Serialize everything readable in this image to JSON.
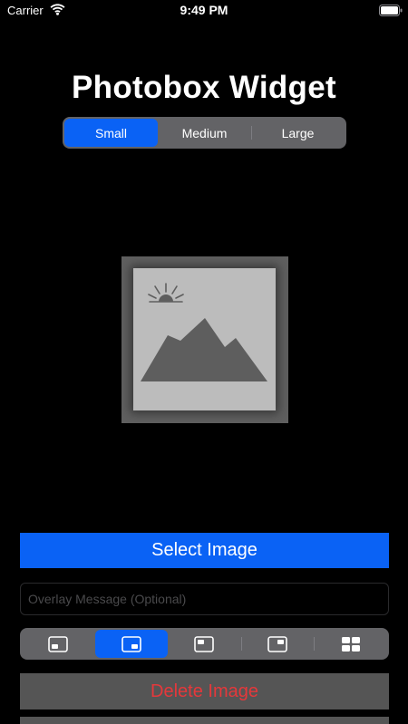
{
  "status_bar": {
    "carrier": "Carrier",
    "time": "9:49 PM",
    "icons": [
      "wifi-icon",
      "battery-icon"
    ]
  },
  "title": "Photobox Widget",
  "size_selector": {
    "options": [
      "Small",
      "Medium",
      "Large"
    ],
    "selected": "Small"
  },
  "preview": {
    "icon": "photo-placeholder-icon"
  },
  "select_button": {
    "label": "Select Image"
  },
  "overlay_field": {
    "value": "",
    "placeholder": "Overlay Message (Optional)"
  },
  "position_selector": {
    "options": [
      {
        "icon": "position-bottom-left-icon"
      },
      {
        "icon": "position-bottom-right-icon"
      },
      {
        "icon": "position-top-left-icon"
      },
      {
        "icon": "position-top-right-icon"
      },
      {
        "icon": "position-grid-icon"
      }
    ],
    "selected_index": 1
  },
  "delete_button": {
    "label": "Delete Image"
  },
  "colors": {
    "accent": "#0a62f5",
    "destructive": "#e5383b",
    "segment_background": "#636366",
    "background": "#000000"
  }
}
